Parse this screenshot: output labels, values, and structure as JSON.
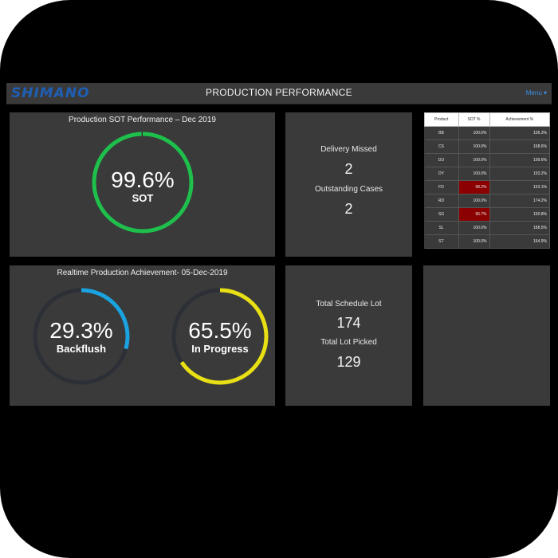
{
  "app": {
    "logo": "SHIMANO",
    "title": "PRODUCTION PERFORMANCE",
    "menu": "Menu ▾"
  },
  "sot_panel": {
    "title": "Production SOT Performance – Dec 2019",
    "value": "99.6%",
    "label": "SOT",
    "fraction": 0.996,
    "color": "#1fbf4c"
  },
  "delivery_panel": {
    "missed_label": "Delivery Missed",
    "missed_value": "2",
    "outstanding_label": "Outstanding Cases",
    "outstanding_value": "2"
  },
  "product_table": {
    "headers": [
      "Product",
      "SOT %",
      "Achievement %"
    ],
    "rows": [
      {
        "product": "BB",
        "sot": "100.0%",
        "achievement": "106.3%",
        "flag": false
      },
      {
        "product": "CS",
        "sot": "100.0%",
        "achievement": "168.6%",
        "flag": false
      },
      {
        "product": "DU",
        "sot": "100.0%",
        "achievement": "199.6%",
        "flag": false
      },
      {
        "product": "DY",
        "sot": "100.0%",
        "achievement": "193.2%",
        "flag": false
      },
      {
        "product": "FD",
        "sot": "98.2%",
        "achievement": "153.1%",
        "flag": true
      },
      {
        "product": "RD",
        "sot": "100.0%",
        "achievement": "174.2%",
        "flag": false
      },
      {
        "product": "SG",
        "sot": "96.7%",
        "achievement": "150.8%",
        "flag": true
      },
      {
        "product": "SL",
        "sot": "100.0%",
        "achievement": "188.5%",
        "flag": false
      },
      {
        "product": "ST",
        "sot": "100.0%",
        "achievement": "164.9%",
        "flag": false
      }
    ],
    "flag_color": "#8b0000"
  },
  "realtime_panel": {
    "title": "Realtime Production Achievement- 05-Dec-2019",
    "backflush": {
      "value": "29.3%",
      "label": "Backflush",
      "fraction": 0.293,
      "color": "#1aa3e0"
    },
    "in_progress": {
      "value": "65.5%",
      "label": "In Progress",
      "fraction": 0.655,
      "color": "#e8e014"
    }
  },
  "lot_panel": {
    "schedule_label": "Total Schedule Lot",
    "schedule_value": "174",
    "picked_label": "Total Lot Picked",
    "picked_value": "129"
  },
  "colors": {
    "track": "#2c3036",
    "panel": "#3a3a3a"
  }
}
